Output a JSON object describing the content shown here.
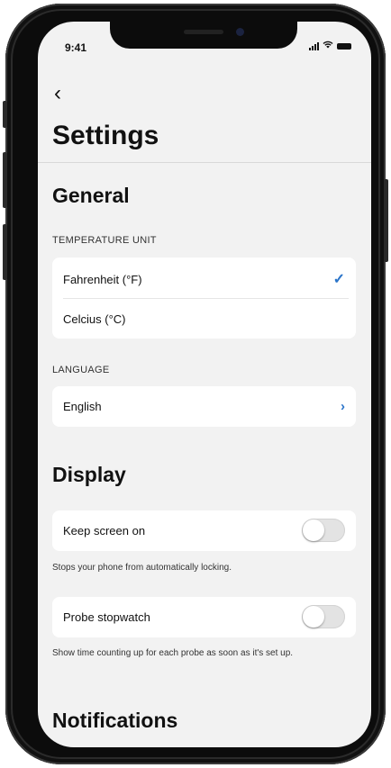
{
  "status_bar": {
    "time": "9:41",
    "signal_icon": "signal-icon",
    "wifi_icon": "wifi-icon",
    "battery_icon": "battery-icon"
  },
  "header": {
    "back_icon": "chevron-left-icon",
    "back_glyph": "‹",
    "title": "Settings"
  },
  "general": {
    "heading": "General",
    "temperature": {
      "label": "TEMPERATURE UNIT",
      "options": [
        {
          "label": "Fahrenheit (°F)",
          "selected": true
        },
        {
          "label": "Celcius (°C)",
          "selected": false
        }
      ],
      "check_glyph": "✓"
    },
    "language": {
      "label": "LANGUAGE",
      "value": "English",
      "chevron_glyph": "›"
    }
  },
  "display": {
    "heading": "Display",
    "keep_screen_on": {
      "label": "Keep screen on",
      "enabled": false,
      "description": "Stops your phone from automatically locking."
    },
    "probe_stopwatch": {
      "label": "Probe stopwatch",
      "enabled": false,
      "description": "Show time counting up for each probe as soon as it's set up."
    }
  },
  "notifications": {
    "heading": "Notifications"
  },
  "colors": {
    "accent": "#2a74c9",
    "background": "#f2f2f2",
    "card": "#ffffff"
  }
}
